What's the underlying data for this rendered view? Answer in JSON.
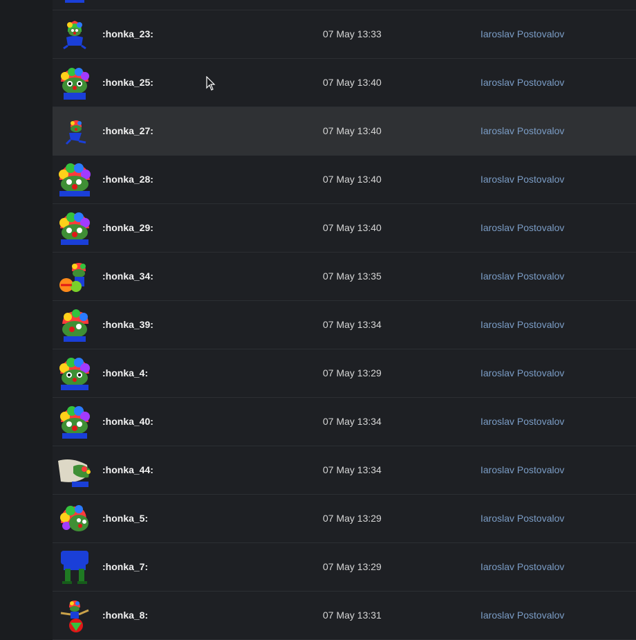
{
  "emoji_list": {
    "rows": [
      {
        "name": "",
        "date": "",
        "author": "",
        "icon": "pepe-clown-emoji"
      },
      {
        "name": ":honka_23:",
        "date": "07 May 13:33",
        "author": "Iaroslav Postovalov",
        "icon": "pepe-clown-emoji"
      },
      {
        "name": ":honka_25:",
        "date": "07 May 13:40",
        "author": "Iaroslav Postovalov",
        "icon": "pepe-clown-emoji"
      },
      {
        "name": ":honka_27:",
        "date": "07 May 13:40",
        "author": "Iaroslav Postovalov",
        "icon": "pepe-clown-emoji"
      },
      {
        "name": ":honka_28:",
        "date": "07 May 13:40",
        "author": "Iaroslav Postovalov",
        "icon": "pepe-clown-emoji"
      },
      {
        "name": ":honka_29:",
        "date": "07 May 13:40",
        "author": "Iaroslav Postovalov",
        "icon": "pepe-clown-emoji"
      },
      {
        "name": ":honka_34:",
        "date": "07 May 13:35",
        "author": "Iaroslav Postovalov",
        "icon": "pepe-clown-juggling-emoji"
      },
      {
        "name": ":honka_39:",
        "date": "07 May 13:34",
        "author": "Iaroslav Postovalov",
        "icon": "pepe-clown-emoji"
      },
      {
        "name": ":honka_4:",
        "date": "07 May 13:29",
        "author": "Iaroslav Postovalov",
        "icon": "pepe-clown-emoji"
      },
      {
        "name": ":honka_40:",
        "date": "07 May 13:34",
        "author": "Iaroslav Postovalov",
        "icon": "pepe-clown-emoji"
      },
      {
        "name": ":honka_44:",
        "date": "07 May 13:34",
        "author": "Iaroslav Postovalov",
        "icon": "hand-holding-clown-emoji"
      },
      {
        "name": ":honka_5:",
        "date": "07 May 13:29",
        "author": "Iaroslav Postovalov",
        "icon": "pepe-clown-emoji"
      },
      {
        "name": ":honka_7:",
        "date": "07 May 13:29",
        "author": "Iaroslav Postovalov",
        "icon": "clown-legs-emoji"
      },
      {
        "name": ":honka_8:",
        "date": "07 May 13:31",
        "author": "Iaroslav Postovalov",
        "icon": "pepe-clown-ball-emoji"
      }
    ]
  },
  "colors": {
    "background": "#1a1c1f",
    "row_background": "#1e2024",
    "row_highlight": "#2f3134",
    "divider": "#2c2f33",
    "author_link": "#7b9dc6"
  }
}
